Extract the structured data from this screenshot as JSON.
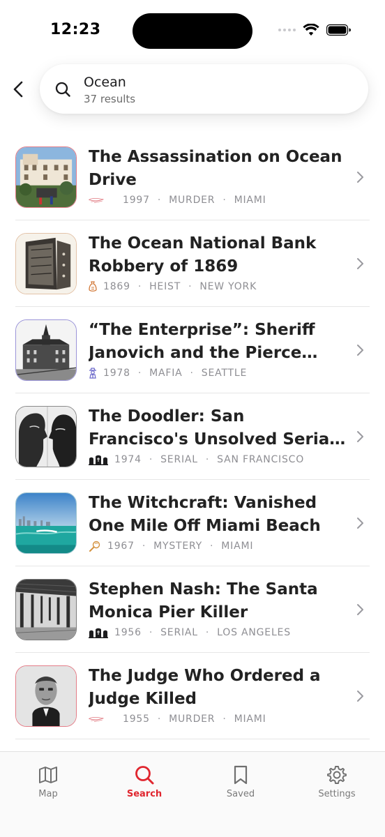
{
  "status_bar": {
    "time": "12:23"
  },
  "search": {
    "query": "Ocean",
    "result_count": "37 results"
  },
  "colors": {
    "accent": "#e0262f",
    "meta_text": "#8e8e93",
    "divider": "#e6e6e6"
  },
  "results": [
    {
      "title": "The Assassination on Ocean Drive",
      "year": "1997",
      "category": "MURDER",
      "city": "MIAMI",
      "category_icon": "knife-icon"
    },
    {
      "title": "The Ocean National Bank Robbery of 1869",
      "year": "1869",
      "category": "HEIST",
      "city": "NEW YORK",
      "category_icon": "money-bag-icon"
    },
    {
      "title": "“The Enterprise”: Sheriff Janovich and the Pierce County Mob",
      "year": "1978",
      "category": "MAFIA",
      "city": "SEATTLE",
      "category_icon": "mobster-icon"
    },
    {
      "title": "The Doodler: San Francisco's Unsolved Serial Killer of Gay Men",
      "year": "1974",
      "category": "SERIAL",
      "city": "SAN FRANCISCO",
      "category_icon": "graves-icon"
    },
    {
      "title": "The Witchcraft: Vanished One Mile Off Miami Beach",
      "year": "1967",
      "category": "MYSTERY",
      "city": "MIAMI",
      "category_icon": "magnifier-icon"
    },
    {
      "title": "Stephen Nash: The Santa Monica Pier Killer",
      "year": "1956",
      "category": "SERIAL",
      "city": "LOS ANGELES",
      "category_icon": "graves-icon"
    },
    {
      "title": "The Judge Who Ordered a Judge Killed",
      "year": "1955",
      "category": "MURDER",
      "city": "MIAMI",
      "category_icon": "knife-icon"
    }
  ],
  "tabs": [
    {
      "label": "Map",
      "icon": "map-icon",
      "active": false
    },
    {
      "label": "Search",
      "icon": "search-icon",
      "active": true
    },
    {
      "label": "Saved",
      "icon": "bookmark-icon",
      "active": false
    },
    {
      "label": "Settings",
      "icon": "gear-icon",
      "active": false
    }
  ]
}
